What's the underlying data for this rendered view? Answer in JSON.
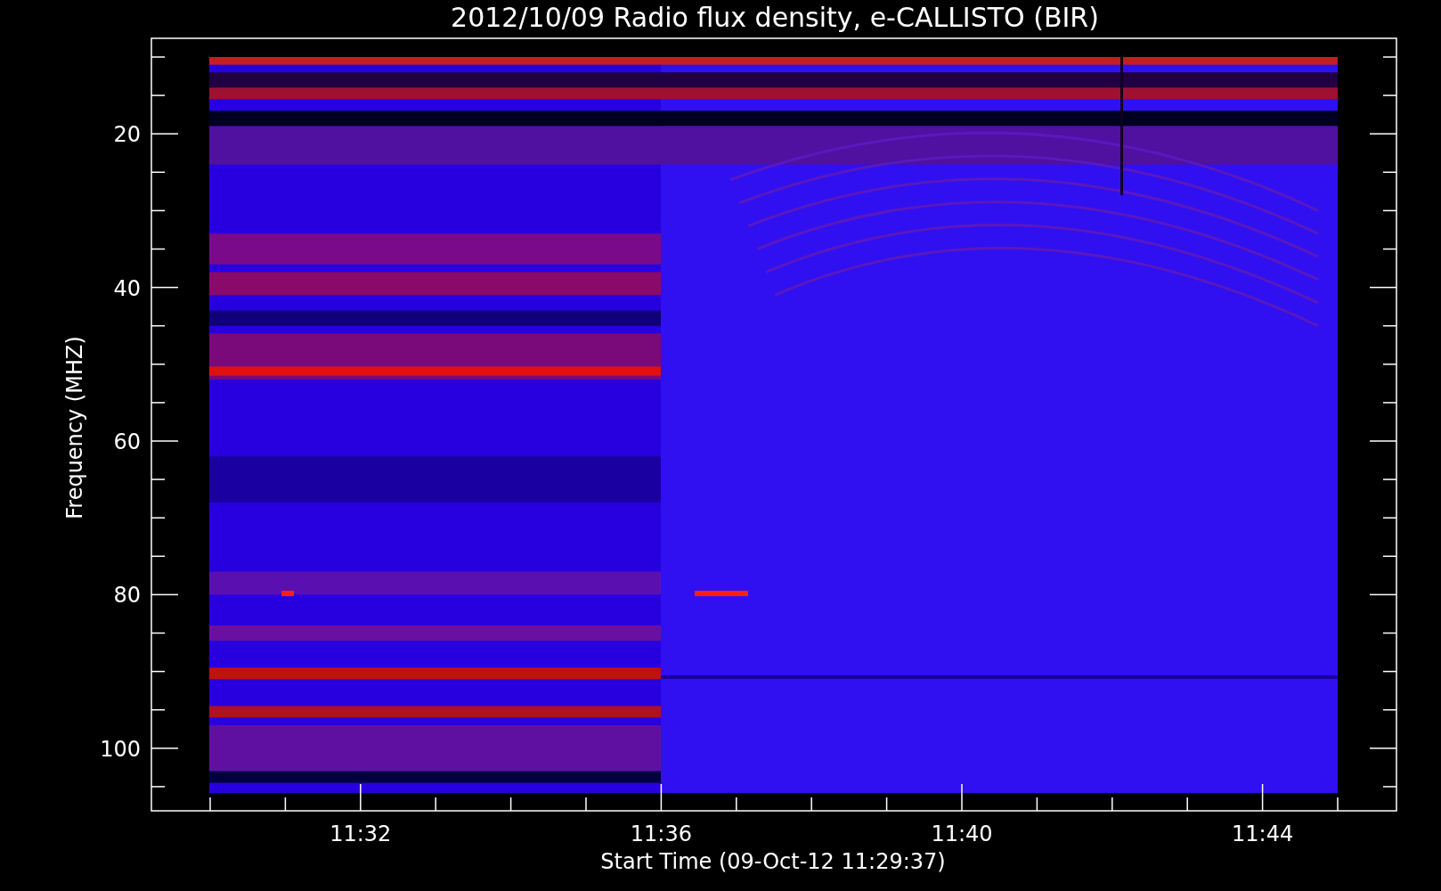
{
  "title": "2012/10/09  Radio flux density, e-CALLISTO (BIR)",
  "y_axis": {
    "label": "Frequency (MHZ)",
    "ticks": [
      "20",
      "40",
      "60",
      "80",
      "100"
    ]
  },
  "x_axis": {
    "label": "Start Time (09-Oct-12 11:29:37)",
    "ticks": [
      "11:32",
      "11:36",
      "11:40",
      "11:44"
    ]
  }
}
